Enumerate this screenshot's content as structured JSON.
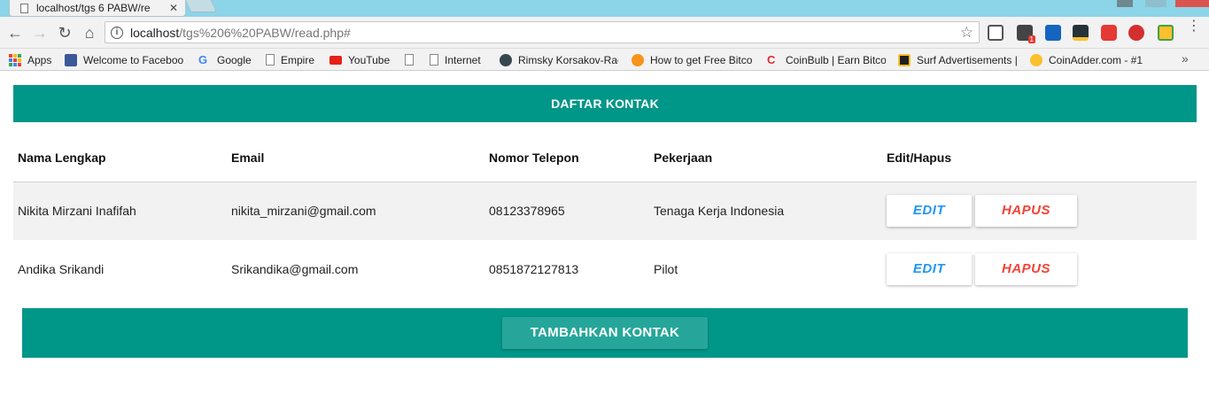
{
  "browser": {
    "tab_title": "localhost/tgs 6 PABW/re",
    "url_host": "localhost",
    "url_path": "/tgs%206%20PABW/read.php#",
    "bookmarks": [
      {
        "label": "Apps",
        "icon": "apps-grid-icon"
      },
      {
        "label": "Welcome to Faceboo",
        "icon": "facebook-icon"
      },
      {
        "label": "Google",
        "icon": "google-icon"
      },
      {
        "label": "Empire",
        "icon": "page-icon"
      },
      {
        "label": "YouTube",
        "icon": "youtube-icon"
      },
      {
        "label": "",
        "icon": "page-icon"
      },
      {
        "label": "Internet",
        "icon": "page-icon"
      },
      {
        "label": "Rimsky Korsakov-Rac",
        "icon": "rimsky-icon"
      },
      {
        "label": "How to get Free Bitco",
        "icon": "bitcoin-icon"
      },
      {
        "label": "CoinBulb | Earn Bitcoi",
        "icon": "coinbulb-icon"
      },
      {
        "label": "Surf Advertisements |",
        "icon": "surf-icon"
      },
      {
        "label": "CoinAdder.com - #1",
        "icon": "coinadder-icon"
      }
    ],
    "colors": {
      "tabstrip": "#8cd4e8",
      "toolbar": "#f2f2f2"
    }
  },
  "page": {
    "header_title": "DAFTAR KONTAK",
    "table": {
      "headers": [
        "Nama Lengkap",
        "Email",
        "Nomor Telepon",
        "Pekerjaan",
        "Edit/Hapus"
      ],
      "rows": [
        {
          "nama": "Nikita Mirzani Inafifah",
          "email": "nikita_mirzani@gmail.com",
          "telepon": "08123378965",
          "pekerjaan": "Tenaga Kerja Indonesia"
        },
        {
          "nama": "Andika Srikandi",
          "email": "Srikandika@gmail.com",
          "telepon": "0851872127813",
          "pekerjaan": "Pilot"
        }
      ]
    },
    "edit_label": "EDIT",
    "hapus_label": "HAPUS",
    "add_label": "TAMBAHKAN KONTAK",
    "colors": {
      "primary": "#009688",
      "add_button": "#26a69a",
      "edit": "#2196f3",
      "hapus": "#f44336"
    }
  }
}
